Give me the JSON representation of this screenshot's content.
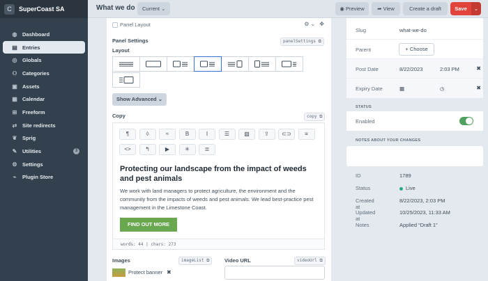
{
  "brand": {
    "name": "SuperCoast SA",
    "logo_letter": "C"
  },
  "sidebar": {
    "items": [
      {
        "label": "Dashboard",
        "icon": "dashboard-icon",
        "glyph": "◍"
      },
      {
        "label": "Entries",
        "icon": "entries-icon",
        "glyph": "▤"
      },
      {
        "label": "Globals",
        "icon": "globe-icon",
        "glyph": "◎"
      },
      {
        "label": "Categories",
        "icon": "categories-icon",
        "glyph": "⚇"
      },
      {
        "label": "Assets",
        "icon": "assets-icon",
        "glyph": "▣"
      },
      {
        "label": "Calendar",
        "icon": "calendar-icon",
        "glyph": "▦"
      },
      {
        "label": "Freeform",
        "icon": "freeform-icon",
        "glyph": "⊞"
      },
      {
        "label": "Site redirects",
        "icon": "redirect-icon",
        "glyph": "⇄"
      },
      {
        "label": "Sprig",
        "icon": "sprig-icon",
        "glyph": "❦"
      },
      {
        "label": "Utilities",
        "icon": "wrench-icon",
        "glyph": "✎",
        "badge": "3"
      },
      {
        "label": "Settings",
        "icon": "gear-icon",
        "glyph": "⚙"
      },
      {
        "label": "Plugin Store",
        "icon": "plug-icon",
        "glyph": "⌁"
      }
    ],
    "active_index": 1
  },
  "header": {
    "title": "What we do",
    "site_select": "Current",
    "preview_label": "Preview",
    "view_label": "View",
    "draft_label": "Create a draft",
    "save_label": "Save"
  },
  "main": {
    "panel_layout_label": "Panel Layout",
    "panel_settings_label": "Panel Settings",
    "panel_settings_handle": "panelSettings",
    "layout_label": "Layout",
    "layout_selected_index": 3,
    "show_advanced_label": "Show Advanced",
    "copy_label": "Copy",
    "copy_handle": "copy",
    "toolbar": [
      "¶",
      "◊",
      "≈",
      "B",
      "I",
      "☰",
      "▨",
      "⇪",
      "⊂⊃",
      "≡",
      "<>",
      "↰",
      "▶",
      "✳",
      "≣"
    ],
    "editor": {
      "heading": "Protecting our landscape from the impact of weeds and pest animals",
      "body": "We work with land managers to protect agriculture, the environment and the community from the impacts of weeds and pest animals. We lead best-practice pest management in the Limestone Coast.",
      "cta": "FIND OUT MORE",
      "words": "words: 44",
      "chars": "chars: 273"
    },
    "images_label": "Images",
    "images_handle": "imageList",
    "image_name": "Protect banner",
    "video_label": "Video URL",
    "video_handle": "videoUrl"
  },
  "side": {
    "slug_label": "Slug",
    "slug_value": "what-we-do",
    "parent_label": "Parent",
    "choose_label": "Choose",
    "post_date_label": "Post Date",
    "post_date": "8/22/2023",
    "post_time": "2:03 PM",
    "expiry_date_label": "Expiry Date",
    "status_heading": "STATUS",
    "enabled_label": "Enabled",
    "enabled": true,
    "notes_heading": "NOTES ABOUT YOUR CHANGES",
    "info": [
      {
        "label": "ID",
        "value": "1789"
      },
      {
        "label": "Status",
        "value": "Live"
      },
      {
        "label": "Created at",
        "value": "8/22/2023, 2:03 PM"
      },
      {
        "label": "Updated at",
        "value": "10/25/2023, 11:33 AM"
      },
      {
        "label": "Notes",
        "value": "Applied “Draft 1”"
      }
    ]
  },
  "colors": {
    "sidebar_bg": "#33404d",
    "save_red": "#e0443a",
    "toggle_green": "#50a161",
    "cta_green": "#6aa84f",
    "selected_blue": "#3a6fd6"
  }
}
